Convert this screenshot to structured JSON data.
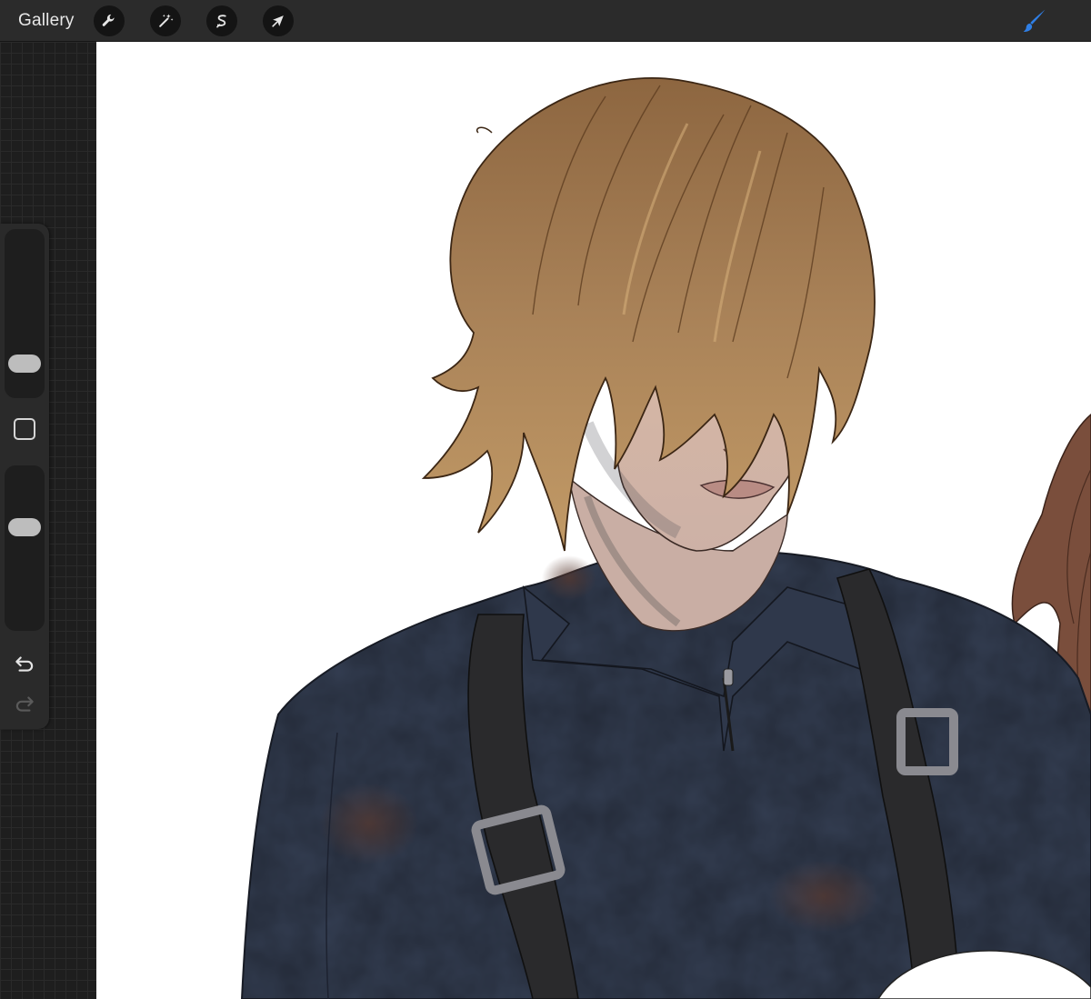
{
  "toolbar": {
    "gallery_label": "Gallery",
    "actions_icon": "wrench-icon",
    "adjustments_icon": "magic-wand-icon",
    "selection_icon": "selection-s-icon",
    "transform_icon": "arrow-cursor-icon",
    "brush_icon": "paintbrush-icon"
  },
  "sidebar": {
    "brush_size_level": 0.85,
    "opacity_level": 0.35
  },
  "colors": {
    "toolbar_bg": "#2b2b2b",
    "sidebar_bg": "#2a2a2a",
    "accent_brush": "#2f7fe6",
    "hair": "#a27a50",
    "shirt": "#343e52",
    "strap": "#2a2a2c",
    "skin": "#d8bfb2"
  }
}
